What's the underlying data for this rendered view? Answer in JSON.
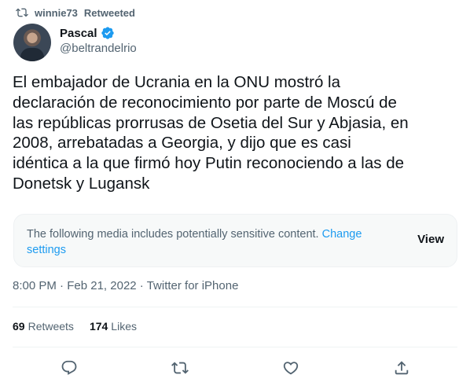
{
  "retweet": {
    "user": "winnie73",
    "label": "Retweeted",
    "icon": "retweet-icon"
  },
  "author": {
    "name": "Pascal",
    "handle": "@beltrandelrio",
    "verified_icon": "verified-badge-icon",
    "verified_color": "#1d9bf0"
  },
  "tweet": {
    "lines": [
      "El embajador de Ucrania en la ONU mostró la",
      "declaración de reconocimiento por parte de Moscú de",
      "las repúblicas prorrusas de Osetia del Sur y Abjasia, en",
      "2008, arrebatadas a Georgia, y dijo que es casi",
      "idéntica a la que firmó hoy Putin reconociendo a las de",
      "Donetsk y Lugansk"
    ]
  },
  "sensitive": {
    "text": "The following media includes potentially sensitive content.",
    "link": "Change settings",
    "button": "View"
  },
  "meta": {
    "time": "8:00 PM",
    "sep": "·",
    "date": "Feb 21, 2022",
    "source": "Twitter for iPhone"
  },
  "stats": {
    "retweets_count": "69",
    "retweets_label": "Retweets",
    "likes_count": "174",
    "likes_label": "Likes"
  },
  "actions": [
    "reply-icon",
    "retweet-icon",
    "like-icon",
    "share-icon"
  ],
  "colors": {
    "accent": "#1d9bf0",
    "text": "#0f1419",
    "secondary": "#536471"
  }
}
